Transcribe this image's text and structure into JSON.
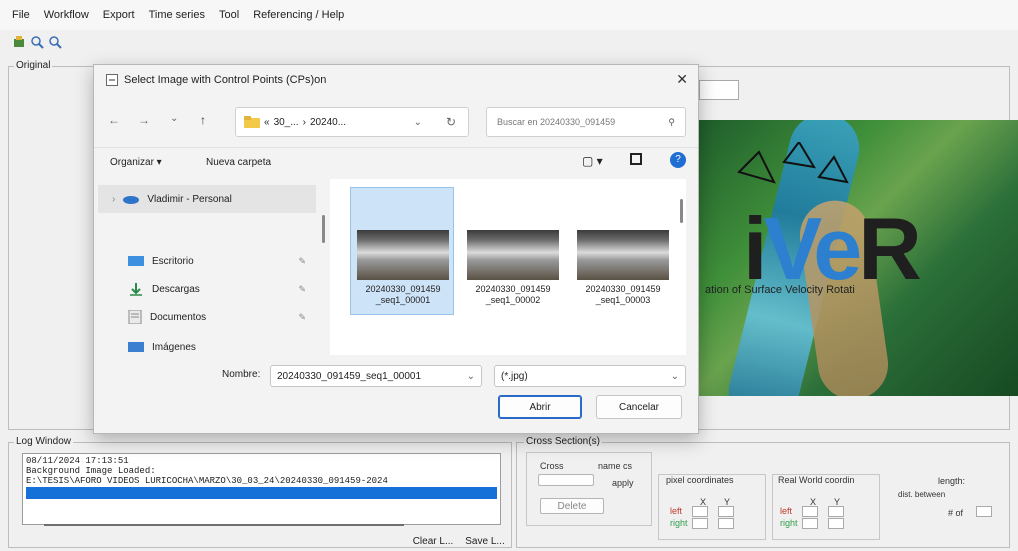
{
  "menu": [
    "File",
    "Workflow",
    "Export",
    "Time series",
    "Tool",
    "Referencing / Help"
  ],
  "panels": {
    "original_title": "Original",
    "log_title": "Log Window",
    "cross_title": "Cross Section(s)"
  },
  "main_image": {
    "logo_r": "R",
    "logo_v": "Ve",
    "logo_prefix": "i",
    "subtitle": "ation of Surface Velocity Rotati"
  },
  "log": {
    "line1": "08/11/2024 17:13:51",
    "line2": "Background Image Loaded:",
    "line3": "E:\\TESIS\\AFORO VIDEOS LURICOCHA\\MARZO\\30_03_24\\20240330_091459-2024"
  },
  "log_buttons": {
    "clear": "Clear L...",
    "save": "Save L..."
  },
  "cross": {
    "cross_label": "Cross",
    "name_label": "name cs",
    "apply_label": "apply",
    "delete_label": "Delete",
    "pixel_title": "pixel coordinates",
    "world_title": "Real World coordin",
    "left_label": "left",
    "right_label": "right",
    "x_label": "X",
    "y_label": "Y",
    "length_label": "length:",
    "dist_label": "dist. between",
    "num_label": "# of"
  },
  "dialog": {
    "title": "Select Image with Control Points (CPs)on",
    "address_parts": [
      "«",
      "30_...",
      "›",
      "20240..."
    ],
    "search_placeholder": "Buscar en 20240330_091459",
    "organize": "Organizar ▾",
    "new_folder": "Nueva carpeta",
    "nav_items": [
      {
        "label": "Vladimir - Personal",
        "icon": "cloud-icon"
      },
      {
        "label": "Escritorio",
        "icon": "desktop-icon"
      },
      {
        "label": "Descargas",
        "icon": "download-icon"
      },
      {
        "label": "Documentos",
        "icon": "documents-icon"
      },
      {
        "label": "Imágenes",
        "icon": "images-icon"
      }
    ],
    "files": [
      {
        "name_line1": "20240330_091459",
        "name_line2": "_seq1_00001",
        "selected": true
      },
      {
        "name_line1": "20240330_091459",
        "name_line2": "_seq1_00002",
        "selected": false
      },
      {
        "name_line1": "20240330_091459",
        "name_line2": "_seq1_00003",
        "selected": false
      }
    ],
    "name_label": "Nombre:",
    "name_value": "20240330_091459_seq1_00001",
    "filter_value": "(*.jpg)",
    "open_button": "Abrir",
    "cancel_button": "Cancelar"
  },
  "colors": {
    "accent": "#1571d8",
    "selection": "#cde3f8",
    "logo_blue": "#2d7fd0"
  }
}
